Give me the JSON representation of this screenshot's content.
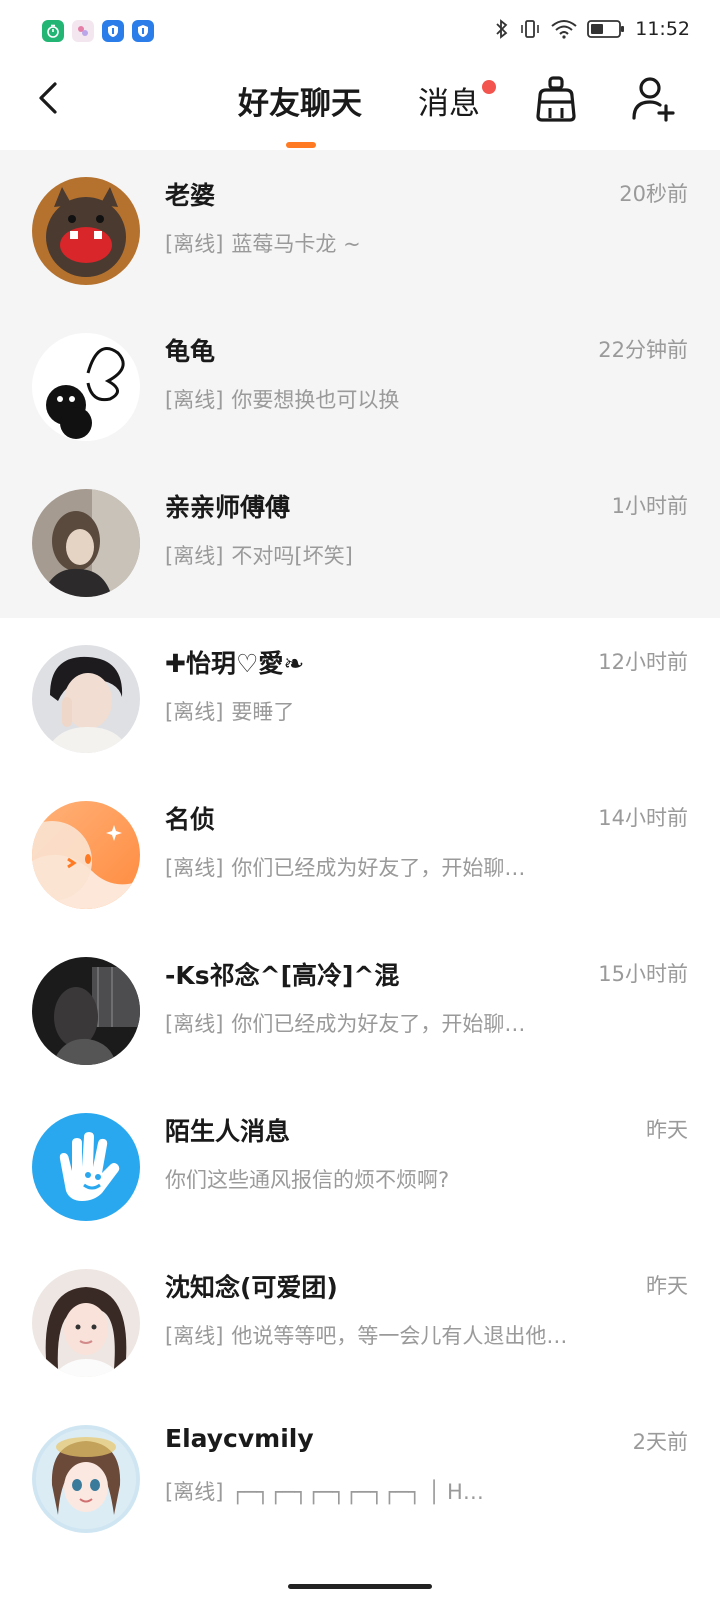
{
  "status_bar": {
    "time": "11:52",
    "left_icons": [
      "timer-app-icon",
      "photo-app-icon",
      "shield-app-icon",
      "shield-app-icon"
    ],
    "right_icons": [
      "bluetooth-icon",
      "vibrate-icon",
      "wifi-icon",
      "battery-icon"
    ],
    "battery_level": 0.4
  },
  "header": {
    "tabs": [
      {
        "label": "好友聊天",
        "active": true
      },
      {
        "label": "消息",
        "active": false,
        "has_unread_dot": true
      }
    ],
    "accent_color": "#ff7a22",
    "unread_dot_color": "#f4544e"
  },
  "chats": [
    {
      "name": "老婆",
      "time": "20秒前",
      "status": "[离线]",
      "preview": "蓝莓马卡龙 ~",
      "pinned": true
    },
    {
      "name": "龟龟",
      "time": "22分钟前",
      "status": "[离线]",
      "preview": "你要想换也可以换",
      "pinned": true
    },
    {
      "name": "亲亲师傅傅",
      "time": "1小时前",
      "status": "[离线]",
      "preview": "不对吗[坏笑]",
      "pinned": true
    },
    {
      "name": "✚怡玥♡愛❧",
      "time": "12小时前",
      "status": "[离线]",
      "preview": "要睡了",
      "pinned": false
    },
    {
      "name": "名侦",
      "time": "14小时前",
      "status": "[离线]",
      "preview": "你们已经成为好友了，开始聊…",
      "pinned": false
    },
    {
      "name": "-Ks祁念^[高冷]^混",
      "time": "15小时前",
      "status": "[离线]",
      "preview": "你们已经成为好友了，开始聊…",
      "pinned": false
    },
    {
      "name": "陌生人消息",
      "time": "昨天",
      "status": "",
      "preview": "你们这些通风报信的烦不烦啊?",
      "pinned": false
    },
    {
      "name": "沈知念(可爱团)",
      "time": "昨天",
      "status": "[离线]",
      "preview": "他说等等吧，等一会儿有人退出他…",
      "pinned": false
    },
    {
      "name": "Elaycvmily",
      "time": "2天前",
      "status": "[离线]",
      "preview": "┌─┐┌─┐┌─┐┌─┐┌─┐  │ H…",
      "pinned": false
    }
  ]
}
